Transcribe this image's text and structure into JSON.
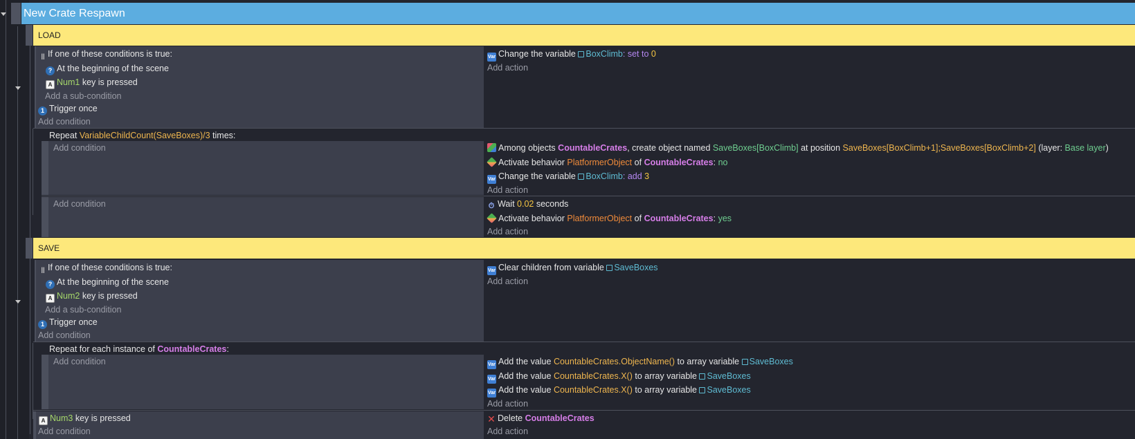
{
  "group": {
    "title": "New Crate Respawn"
  },
  "load": {
    "comment": "LOAD",
    "event1": {
      "or_label": "If one of these conditions is true:",
      "cond_begin": "At the beginning of the scene",
      "key_name": "Num1",
      "key_text": "key is pressed",
      "add_subcondition": "Add a sub-condition",
      "trigger_once": "Trigger once",
      "add_condition": "Add condition",
      "action_change": "Change the variable",
      "action_var": "BoxClimb",
      "action_op": ": set to",
      "action_value": "0",
      "add_action": "Add action"
    },
    "repeat": {
      "prefix": "Repeat",
      "expr": "VariableChildCount(SaveBoxes)/3",
      "suffix": "times:",
      "sub1": {
        "add_condition": "Add condition",
        "create_prefix": "Among objects",
        "create_obj": "CountableCrates",
        "create_mid": ", create object named",
        "create_name": "SaveBoxes[BoxClimb]",
        "create_at": "at position",
        "create_pos": "SaveBoxes[BoxClimb+1];SaveBoxes[BoxClimb+2]",
        "create_layer_prefix": "(layer:",
        "create_layer": "Base layer",
        "create_layer_suffix": ")",
        "behav_prefix": "Activate behavior",
        "behav_name": "PlatformerObject",
        "behav_of": "of",
        "behav_obj": "CountableCrates",
        "behav_colon": ":",
        "behav_value": "no",
        "change_prefix": "Change the variable",
        "change_var": "BoxClimb",
        "change_op": ": add",
        "change_value": "3",
        "add_action": "Add action"
      },
      "sub2": {
        "add_condition": "Add condition",
        "wait_prefix": "Wait",
        "wait_value": "0.02",
        "wait_suffix": "seconds",
        "behav_prefix": "Activate behavior",
        "behav_name": "PlatformerObject",
        "behav_of": "of",
        "behav_obj": "CountableCrates",
        "behav_colon": ":",
        "behav_value": "yes",
        "add_action": "Add action"
      }
    }
  },
  "save": {
    "comment": "SAVE",
    "event1": {
      "or_label": "If one of these conditions is true:",
      "cond_begin": "At the beginning of the scene",
      "key_name": "Num2",
      "key_text": "key is pressed",
      "add_subcondition": "Add a sub-condition",
      "trigger_once": "Trigger once",
      "add_condition": "Add condition",
      "action_clear": "Clear children from variable",
      "action_var": "SaveBoxes",
      "add_action": "Add action"
    },
    "foreach": {
      "prefix": "Repeat for each instance of",
      "obj": "CountableCrates",
      "suffix": ":",
      "add_condition": "Add condition",
      "add_prefix": "Add the value",
      "value1": "CountableCrates.ObjectName()",
      "value2": "CountableCrates.X()",
      "value3": "CountableCrates.X()",
      "to_array": "to array variable",
      "array_var": "SaveBoxes",
      "add_action": "Add action"
    }
  },
  "delete_event": {
    "key_name": "Num3",
    "key_text": "key is pressed",
    "add_condition": "Add condition",
    "delete_prefix": "Delete",
    "delete_obj": "CountableCrates",
    "add_action": "Add action"
  },
  "colors": {
    "group_header": "#5cade0",
    "comment_bg": "#fde87b",
    "condition_bg": "#3c3f4c",
    "action_bg": "#23252e",
    "number": "#f5c542",
    "variable": "#5fbcd3",
    "object": "#d67ee8",
    "expression": "#efb64f"
  }
}
